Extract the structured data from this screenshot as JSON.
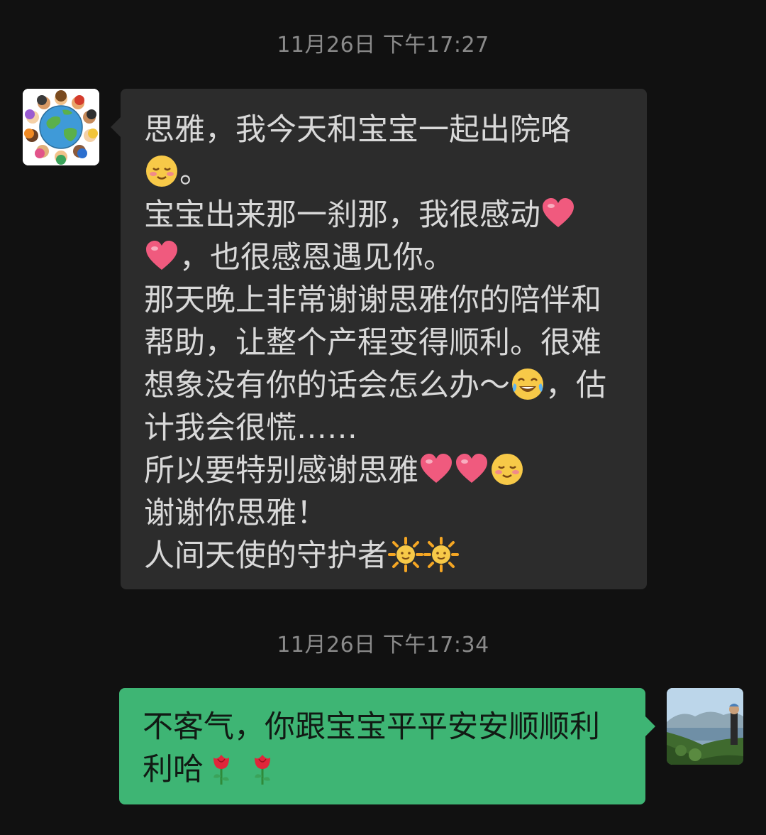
{
  "timestamps": [
    "11月26日 下午17:27",
    "11月26日 下午17:34"
  ],
  "message_left": {
    "sender_avatar": "globe-children-avatar",
    "lines": [
      [
        "思雅，我今天和宝宝一起出院咯"
      ],
      [
        "",
        "。"
      ],
      [
        "宝宝出来那一刹那，我很感动"
      ],
      [
        "",
        "，也很感恩遇见你。"
      ],
      [
        "那天晚上非常谢谢思雅你的陪伴和"
      ],
      [
        "帮助，让整个产程变得顺利。很难"
      ],
      [
        "想象没有你的话会怎么办～",
        "，估"
      ],
      [
        "计我会很慌……"
      ],
      [
        "所以要特别感谢思雅"
      ],
      [
        "谢谢你思雅！"
      ],
      [
        "人间天使的守护者"
      ]
    ]
  },
  "message_right": {
    "sender_avatar": "mountain-lake-avatar",
    "lines": [
      [
        "不客气，你跟宝宝平平安安顺顺利"
      ],
      [
        "利哈"
      ]
    ]
  },
  "emoji_icons": [
    "shy-smile-emoji",
    "heart-emoji",
    "tears-of-joy-emoji",
    "sun-emoji",
    "rose-emoji"
  ],
  "colors": {
    "background": "#111111",
    "incoming_bubble": "#2c2c2c",
    "outgoing_bubble": "#3eb574",
    "timestamp": "#8a8a8a"
  }
}
